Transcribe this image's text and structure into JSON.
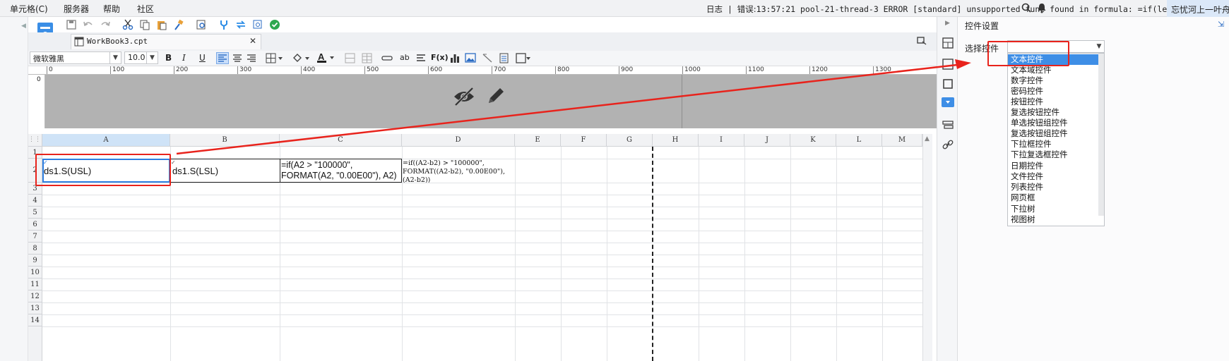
{
  "menubar": {
    "items": [
      "单元格(C)",
      "服务器",
      "帮助",
      "社区"
    ],
    "log_label": "日志",
    "error_label": "错误:",
    "error_message": "13:57:21 pool-21-thread-3 ERROR [standard] unsupported func found in formula: =if(len...",
    "user": "忘忧河上一叶舟"
  },
  "tab": {
    "name": "WorkBook3.cpt"
  },
  "format": {
    "font": "微软雅黑",
    "size": "10.0",
    "bold": "B",
    "italic": "I",
    "underline": "U",
    "text_tool": "ab",
    "formula_tool": "F(x)"
  },
  "ruler": {
    "ticks": [
      "0",
      "100",
      "200",
      "300",
      "400",
      "500",
      "600",
      "700",
      "800",
      "900",
      "1000",
      "1100",
      "1200",
      "1300"
    ],
    "vtick": "0"
  },
  "grid": {
    "columns": [
      "A",
      "B",
      "C",
      "D",
      "E",
      "F",
      "G",
      "H",
      "I",
      "J",
      "K",
      "L",
      "M"
    ],
    "rows": [
      "1",
      "2",
      "3",
      "4",
      "5",
      "6",
      "7",
      "8",
      "9",
      "10",
      "11",
      "12",
      "13",
      "14"
    ],
    "cells": {
      "a2": "ds1.S(USL)",
      "b2": "ds1.S(LSL)",
      "c2_line1": "=if(A2 > \"100000\",",
      "c2_line2": "FORMAT(A2, \"0.00E00\"), A2)",
      "d2_line1": "=if((A2-b2) > \"100000\",",
      "d2_line2": "FORMAT((A2-b2), \"0.00E00\"),",
      "d2_line3": "(A2-b2))"
    }
  },
  "right_panel": {
    "title": "控件设置",
    "select_label": "选择控件",
    "options": [
      "文本控件",
      "文本域控件",
      "数字控件",
      "密码控件",
      "按钮控件",
      "复选按钮控件",
      "单选按钮组控件",
      "复选按钮组控件",
      "下拉框控件",
      "下拉复选框控件",
      "日期控件",
      "文件控件",
      "列表控件",
      "网页框",
      "下拉树",
      "视图树"
    ],
    "selected_index": 0
  },
  "colors": {
    "annotation_red": "#e8231c",
    "selection_blue": "#3e8ee6",
    "active_cell_border": "#2f7fe0"
  }
}
